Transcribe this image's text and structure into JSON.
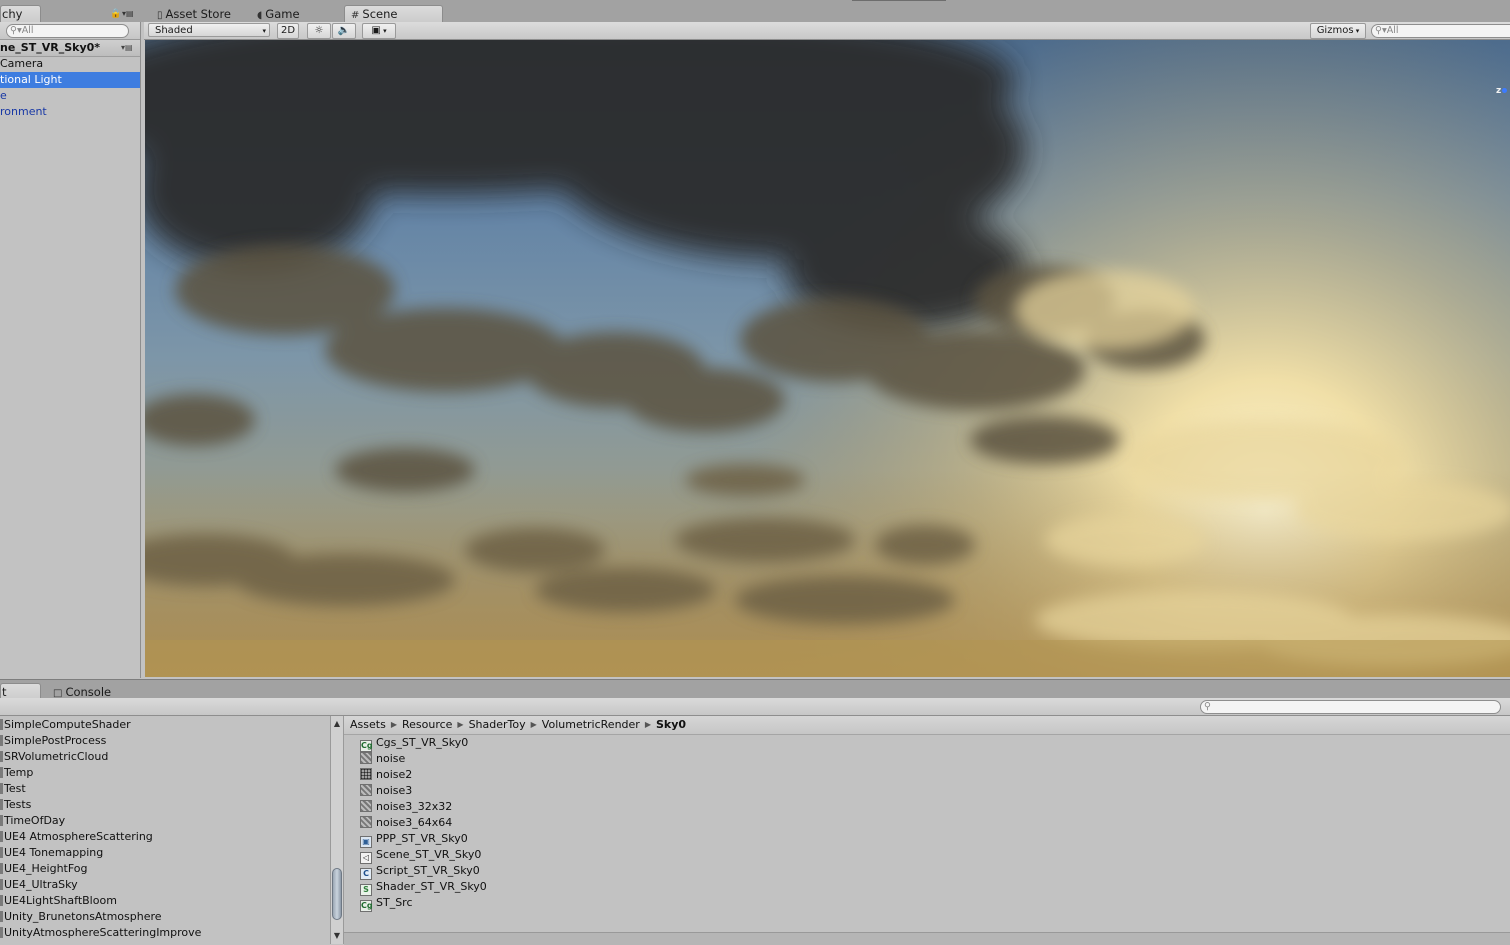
{
  "top_tabs": {
    "hierarchy_label": "chy",
    "asset_store_label": "Asset Store",
    "game_label": "Game",
    "scene_label": "Scene"
  },
  "hierarchy": {
    "search_placeholder": "All",
    "scene_name": "ne_ST_VR_Sky0*",
    "items": [
      {
        "label": "Camera"
      },
      {
        "label": "tional Light"
      },
      {
        "label": "e"
      },
      {
        "label": "ronment"
      }
    ]
  },
  "scene_toolbar": {
    "shading_mode": "Shaded",
    "two_d_label": "2D",
    "gizmos_label": "Gizmos",
    "search_placeholder": "All"
  },
  "gizmo": {
    "axis_label": "z"
  },
  "bottom_tabs": {
    "project_label": "t",
    "console_label": "Console"
  },
  "project_tree": {
    "items": [
      {
        "label": "SimpleComputeShader"
      },
      {
        "label": "SimplePostProcess"
      },
      {
        "label": "SRVolumetricCloud"
      },
      {
        "label": "Temp"
      },
      {
        "label": "Test"
      },
      {
        "label": "Tests"
      },
      {
        "label": "TimeOfDay"
      },
      {
        "label": "UE4 AtmosphereScattering"
      },
      {
        "label": "UE4 Tonemapping"
      },
      {
        "label": "UE4_HeightFog"
      },
      {
        "label": "UE4_UltraSky"
      },
      {
        "label": "UE4LightShaftBloom"
      },
      {
        "label": "Unity_BrunetonsAtmosphere"
      },
      {
        "label": "UnityAtmosphereScatteringImprove"
      }
    ]
  },
  "breadcrumb": {
    "parts": [
      "Assets",
      "Resource",
      "ShaderToy",
      "VolumetricRender",
      "Sky0"
    ]
  },
  "assets": {
    "items": [
      {
        "name": "Cgs_ST_VR_Sky0",
        "icon": "cg-include-icon",
        "glyph": "Cg"
      },
      {
        "name": "noise",
        "icon": "texture-icon",
        "glyph": ""
      },
      {
        "name": "noise2",
        "icon": "texture-icon",
        "glyph": ""
      },
      {
        "name": "noise3",
        "icon": "texture-icon",
        "glyph": ""
      },
      {
        "name": "noise3_32x32",
        "icon": "texture-icon",
        "glyph": ""
      },
      {
        "name": "noise3_64x64",
        "icon": "texture-icon",
        "glyph": ""
      },
      {
        "name": "PPP_ST_VR_Sky0",
        "icon": "postprocess-profile-icon",
        "glyph": ""
      },
      {
        "name": "Scene_ST_VR_Sky0",
        "icon": "unity-scene-icon",
        "glyph": ""
      },
      {
        "name": "Script_ST_VR_Sky0",
        "icon": "csharp-script-icon",
        "glyph": "C"
      },
      {
        "name": "Shader_ST_VR_Sky0",
        "icon": "shader-icon",
        "glyph": "S"
      },
      {
        "name": "ST_Src",
        "icon": "cg-include-icon",
        "glyph": "Cg"
      }
    ]
  },
  "colors": {
    "selection": "#3e7de0",
    "panel": "#c2c2c2",
    "link_blue": "#1838a5"
  }
}
